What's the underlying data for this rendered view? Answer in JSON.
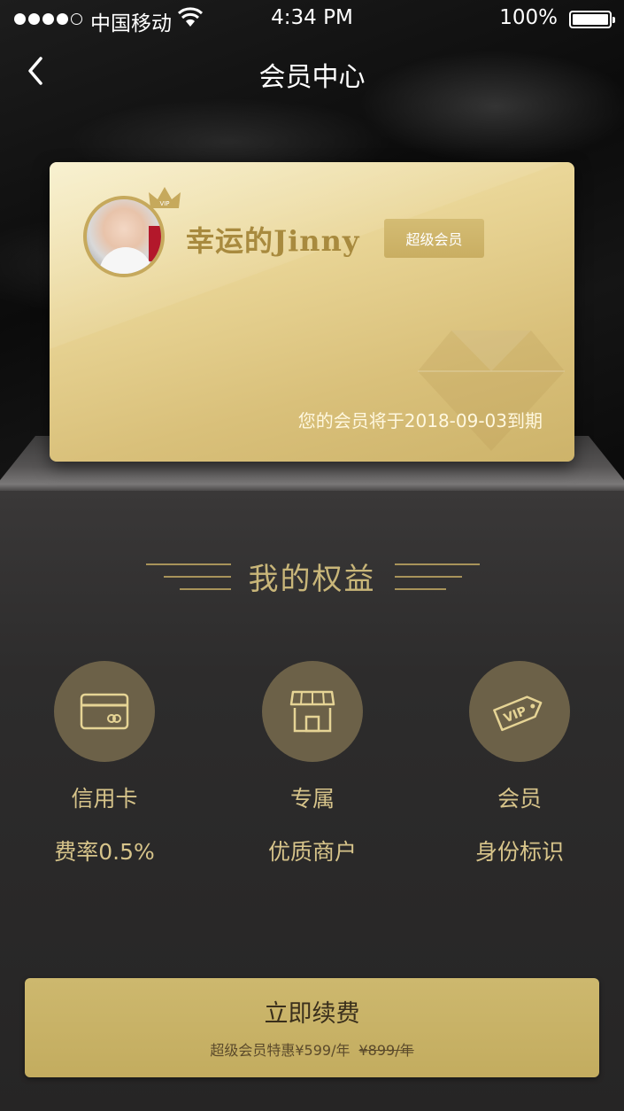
{
  "status_bar": {
    "carrier": "中国移动",
    "time": "4:34 PM",
    "battery": "100%"
  },
  "nav": {
    "title": "会员中心",
    "back_icon": "chevron-left-icon"
  },
  "card": {
    "user_name": "幸运的Jinny",
    "badge": "超级会员",
    "expiry": "您的会员将于2018-09-03到期",
    "crown_text": "VIP",
    "colors": {
      "gold_light": "#f4e9b8",
      "gold_dark": "#cdb36a",
      "name": "#a88a3e"
    }
  },
  "benefits": {
    "heading": "我的权益",
    "items": [
      {
        "icon": "credit-card-icon",
        "line1": "信用卡",
        "line2": "费率0.5%"
      },
      {
        "icon": "store-icon",
        "line1": "专属",
        "line2": "优质商户"
      },
      {
        "icon": "vip-tag-icon",
        "line1": "会员",
        "line2": "身份标识",
        "tag_text": "VIP"
      }
    ]
  },
  "renew": {
    "label": "立即续费",
    "price": "超级会员特惠¥599/年",
    "old_price": "¥899/年"
  },
  "colors": {
    "accent_gold": "#c9b679",
    "icon_circle": "#6c6148",
    "button": "#c8b265"
  }
}
